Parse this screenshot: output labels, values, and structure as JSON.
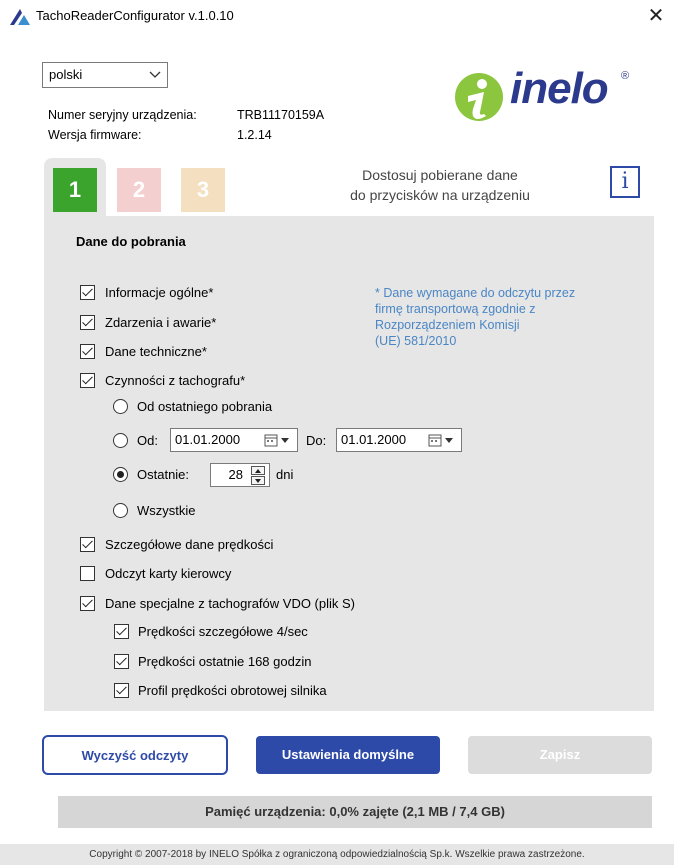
{
  "window": {
    "title": "TachoReaderConfigurator v.1.0.10",
    "close_glyph": "✕"
  },
  "language": {
    "selected": "polski"
  },
  "device": {
    "serial_label": "Numer seryjny urządzenia:",
    "serial_value": "TRB11170159A",
    "firmware_label": "Wersja firmware:",
    "firmware_value": "1.2.14"
  },
  "logo": {
    "text": "inelo",
    "reg": "®"
  },
  "tabs": [
    {
      "label": "1",
      "color": "#3aa42d",
      "active": true
    },
    {
      "label": "2",
      "color": "#f4cfcf",
      "active": false
    },
    {
      "label": "3",
      "color": "#f4dfc0",
      "active": false
    }
  ],
  "header": {
    "line1": "Dostosuj pobierane dane",
    "line2": "do przycisków na urządzeniu",
    "info_glyph": "i"
  },
  "panel": {
    "title": "Dane do pobrania",
    "note_lines": [
      "* Dane wymagane do odczytu przez",
      "firmę transportową zgodnie z",
      "Rozporządzeniem Komisji",
      "(UE) 581/2010"
    ],
    "options": {
      "general": {
        "label": "Informacje ogólne*",
        "checked": true
      },
      "events": {
        "label": "Zdarzenia i awarie*",
        "checked": true
      },
      "technical": {
        "label": "Dane techniczne*",
        "checked": true
      },
      "activities": {
        "label": "Czynności z tachografu*",
        "checked": true
      }
    },
    "range": {
      "since_last": "Od ostatniego pobrania",
      "from_label": "Od:",
      "from_date": "01.01.2000",
      "to_label": "Do:",
      "to_date": "01.01.2000",
      "last_label": "Ostatnie:",
      "last_value": "28",
      "last_unit": "dni",
      "all": "Wszystkie",
      "selected": "last"
    },
    "more": {
      "speed_detail": {
        "label": "Szczegółowe dane prędkości",
        "checked": true
      },
      "driver_card": {
        "label": "Odczyt karty kierowcy",
        "checked": false
      },
      "vdo_special": {
        "label": "Dane specjalne z tachografów VDO (plik S)",
        "checked": true
      },
      "speed_4sec": {
        "label": "Prędkości szczegółowe 4/sec",
        "checked": true
      },
      "speed_168h": {
        "label": "Prędkości ostatnie 168 godzin",
        "checked": true
      },
      "rpm_profile": {
        "label": "Profil prędkości obrotowej silnika",
        "checked": true
      }
    }
  },
  "buttons": {
    "clear": "Wyczyść odczyty",
    "defaults": "Ustawienia domyślne",
    "save": "Zapisz"
  },
  "memory": "Pamięć urządzenia: 0,0% zajęte (2,1 MB / 7,4 GB)",
  "footer": "Copyright © 2007-2018 by INELO Spółka z ograniczoną odpowiedzialnością Sp.k. Wszelkie prawa zastrzeżone.",
  "colors": {
    "accent": "#2e4aa8",
    "green": "#3aa42d",
    "note": "#4a86c5"
  }
}
